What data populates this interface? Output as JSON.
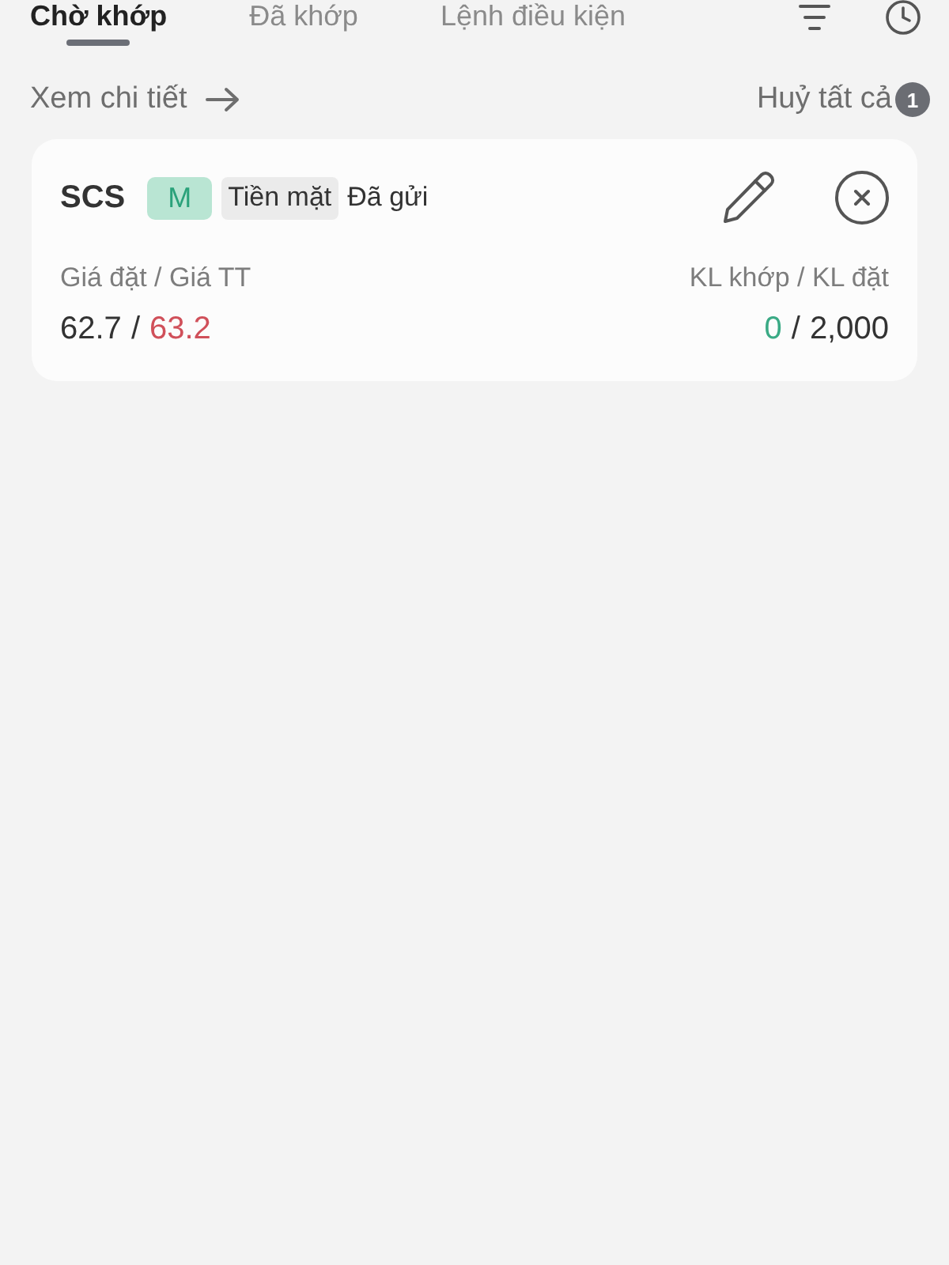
{
  "tabs": [
    {
      "label": "Chờ khớp",
      "selected": true
    },
    {
      "label": "Đã khớp",
      "selected": false
    },
    {
      "label": "Lệnh điều kiện",
      "selected": false
    }
  ],
  "actions": {
    "detail_link": "Xem chi tiết",
    "cancel_all": {
      "label": "Huỷ tất cả",
      "count": "1"
    }
  },
  "orders": [
    {
      "symbol": "SCS",
      "order_type": "M",
      "account_type": "Tiền mặt",
      "status": "Đã gửi",
      "price": {
        "label": "Giá đặt / Giá TT",
        "order": "62.7",
        "separator": "/",
        "market": "63.2",
        "market_down": true
      },
      "volume": {
        "label": "KL khớp / KL đặt",
        "matched": "0",
        "matched_up": true,
        "separator": "/",
        "ordered": "2,000"
      }
    }
  ]
}
